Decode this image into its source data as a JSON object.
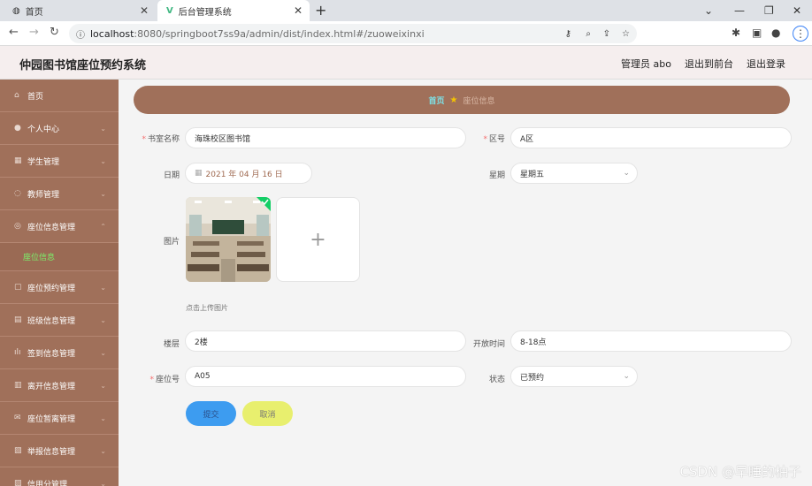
{
  "browser": {
    "tabs": [
      {
        "label": "首页"
      },
      {
        "label": "后台管理系统"
      }
    ],
    "url_host": "localhost",
    "url_path": ":8080/springboot7ss9a/admin/dist/index.html#/zuoweixinxi"
  },
  "header": {
    "title": "仲园图书馆座位预约系统",
    "admin": "管理员 abo",
    "front": "退出到前台",
    "logout": "退出登录"
  },
  "sidebar": {
    "items": [
      {
        "label": "首页",
        "icon": "home-icon"
      },
      {
        "label": "个人中心",
        "icon": "user-icon"
      },
      {
        "label": "学生管理",
        "icon": "grid-icon"
      },
      {
        "label": "教师管理",
        "icon": "pin-icon"
      },
      {
        "label": "座位信息管理",
        "icon": "seat-icon"
      },
      {
        "label": "座位预约管理",
        "icon": "calendar-icon"
      },
      {
        "label": "班级信息管理",
        "icon": "doc-icon"
      },
      {
        "label": "签到信息管理",
        "icon": "chart-icon"
      },
      {
        "label": "离开信息管理",
        "icon": "exit-icon"
      },
      {
        "label": "座位暂离管理",
        "icon": "mail-icon"
      },
      {
        "label": "举报信息管理",
        "icon": "report-icon"
      },
      {
        "label": "信用分管理",
        "icon": "credit-icon"
      }
    ],
    "sub_active": "座位信息"
  },
  "breadcrumb": {
    "home": "首页",
    "current": "座位信息"
  },
  "form": {
    "room_label": "书室名称",
    "room_value": "海珠校区图书馆",
    "area_label": "区号",
    "area_value": "A区",
    "date_label": "日期",
    "date_value": "2021 年 04 月 16 日",
    "week_label": "星期",
    "week_value": "星期五",
    "image_label": "图片",
    "upload_hint": "点击上传图片",
    "floor_label": "楼层",
    "floor_value": "2楼",
    "open_label": "开放时间",
    "open_value": "8-18点",
    "seat_label": "座位号",
    "seat_value": "A05",
    "status_label": "状态",
    "status_value": "已预约",
    "submit": "提交",
    "cancel": "取消"
  },
  "watermark": "CSDN @早睡的柚子"
}
